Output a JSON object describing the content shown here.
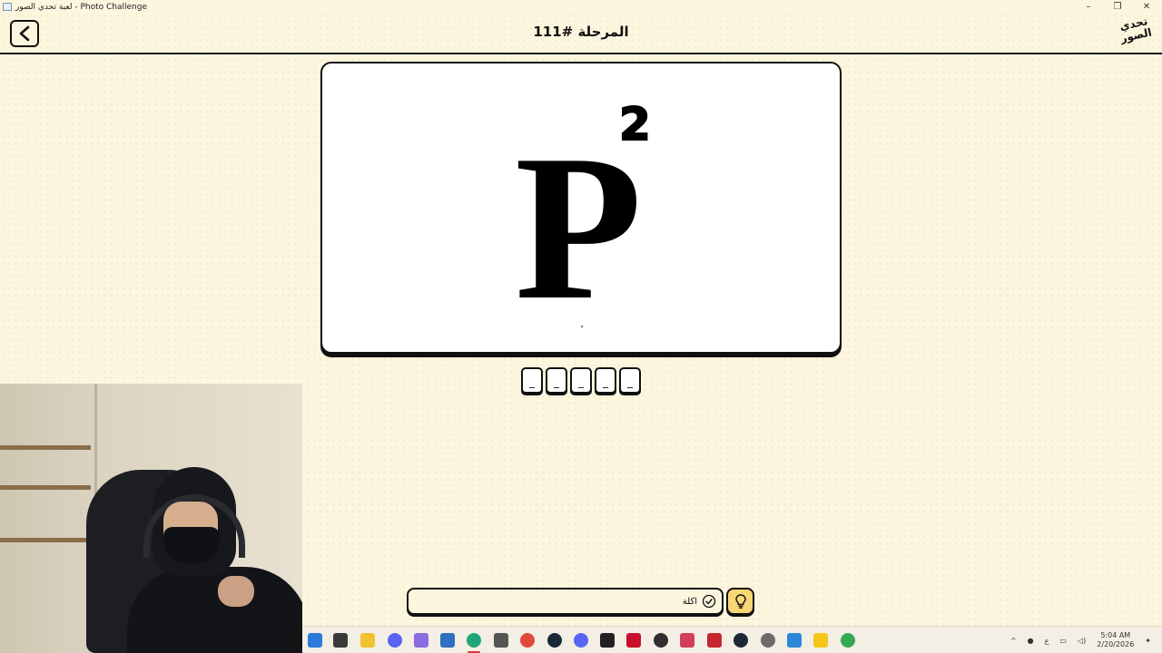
{
  "window": {
    "title": "لعبة تحدي الصور - Photo Challenge",
    "controls": [
      "–",
      "❐",
      "✕"
    ]
  },
  "header": {
    "level_title": "المرحلة #111",
    "back_icon": "chevron-left-icon",
    "logo_text_line1": "تحدي",
    "logo_text_line2": "الصور"
  },
  "puzzle": {
    "glyph": "P",
    "superscript": "2"
  },
  "answer": {
    "slots": [
      "_",
      "_",
      "_",
      "_",
      "_"
    ]
  },
  "guess": {
    "value": "اكلة",
    "check_icon": "check-circle-icon",
    "hint_icon": "lightbulb-icon"
  },
  "taskbar": {
    "apps": [
      "windows-start-icon",
      "task-view-icon",
      "file-explorer-icon",
      "discord-icon",
      "copilot-icon",
      "store-icon",
      "edge-icon",
      "unity-icon",
      "chrome-icon",
      "steam-icon",
      "discord-icon",
      "epic-icon",
      "adobe-icon",
      "obs-icon",
      "app-icon",
      "app-icon",
      "steam-icon",
      "settings-icon",
      "app-icon",
      "app-icon",
      "chrome-icon"
    ],
    "time": "5:04 AM",
    "date": "2/20/2026",
    "lang": "ع"
  },
  "colors": {
    "background": "#fdf6df",
    "accent": "#f7d774",
    "outline": "#111111"
  }
}
